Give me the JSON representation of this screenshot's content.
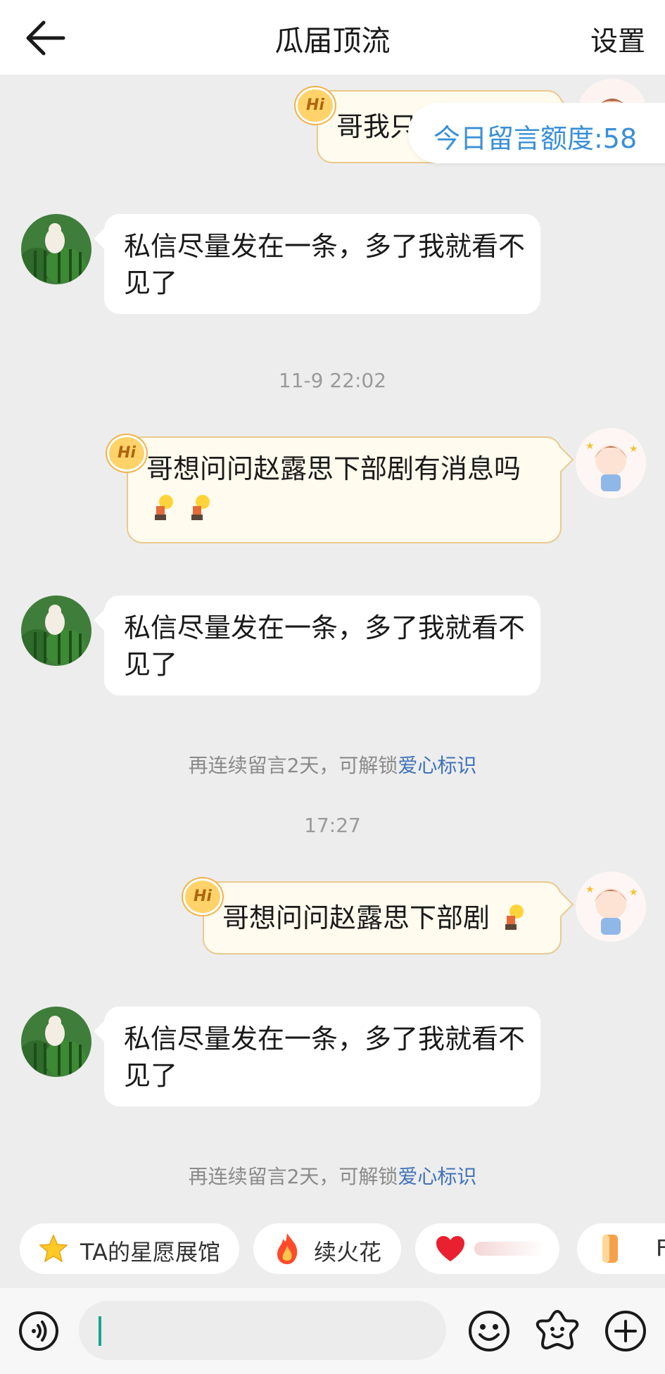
{
  "header": {
    "title": "瓜届顶流",
    "settings_label": "设置",
    "back_icon": "arrow-left-icon"
  },
  "quota": {
    "text": "今日留言额度:58"
  },
  "messages": [
    {
      "type": "out",
      "text": "哥我只",
      "badge": "Hi"
    },
    {
      "type": "in",
      "text": "私信尽量发在一条，多了我就看不见了"
    },
    {
      "type": "out",
      "text": "哥想问问赵露思下部剧有消息吗",
      "emoji": [
        "reading-bulb-emoji",
        "reading-bulb-emoji"
      ],
      "badge": "Hi"
    },
    {
      "type": "in",
      "text": "私信尽量发在一条，多了我就看不见了"
    },
    {
      "type": "out",
      "text": "哥想问问赵露思下部剧",
      "emoji": [
        "reading-bulb-emoji"
      ],
      "badge": "Hi"
    },
    {
      "type": "in",
      "text": "私信尽量发在一条，多了我就看不见了"
    }
  ],
  "timestamps": [
    "11-9 22:02",
    "17:27"
  ],
  "tips": [
    {
      "text": "再连续留言2天，可解锁",
      "link": "爱心标识"
    },
    {
      "text": "再连续留言2天，可解锁",
      "link": "爱心标识"
    }
  ],
  "chips": [
    {
      "label": "TA的星愿展馆",
      "icon": "star-icon"
    },
    {
      "label": "续火花",
      "icon": "fire-icon"
    },
    {
      "label": "",
      "icon": "heart-icon"
    },
    {
      "label": "F",
      "icon": "gift-icon"
    }
  ],
  "input": {
    "value": "",
    "placeholder": ""
  },
  "toolbar": {
    "voice_icon": "voice-icon",
    "emoji_icon": "smiley-icon",
    "sticker_icon": "sticker-icon",
    "add_icon": "plus-icon"
  },
  "colors": {
    "accent_teal": "#18a58f",
    "link_blue": "#3f72b8",
    "quota_blue": "#3a8fd6",
    "bubble_out": "#fffbee",
    "bubble_out_border": "#e9c98e"
  }
}
